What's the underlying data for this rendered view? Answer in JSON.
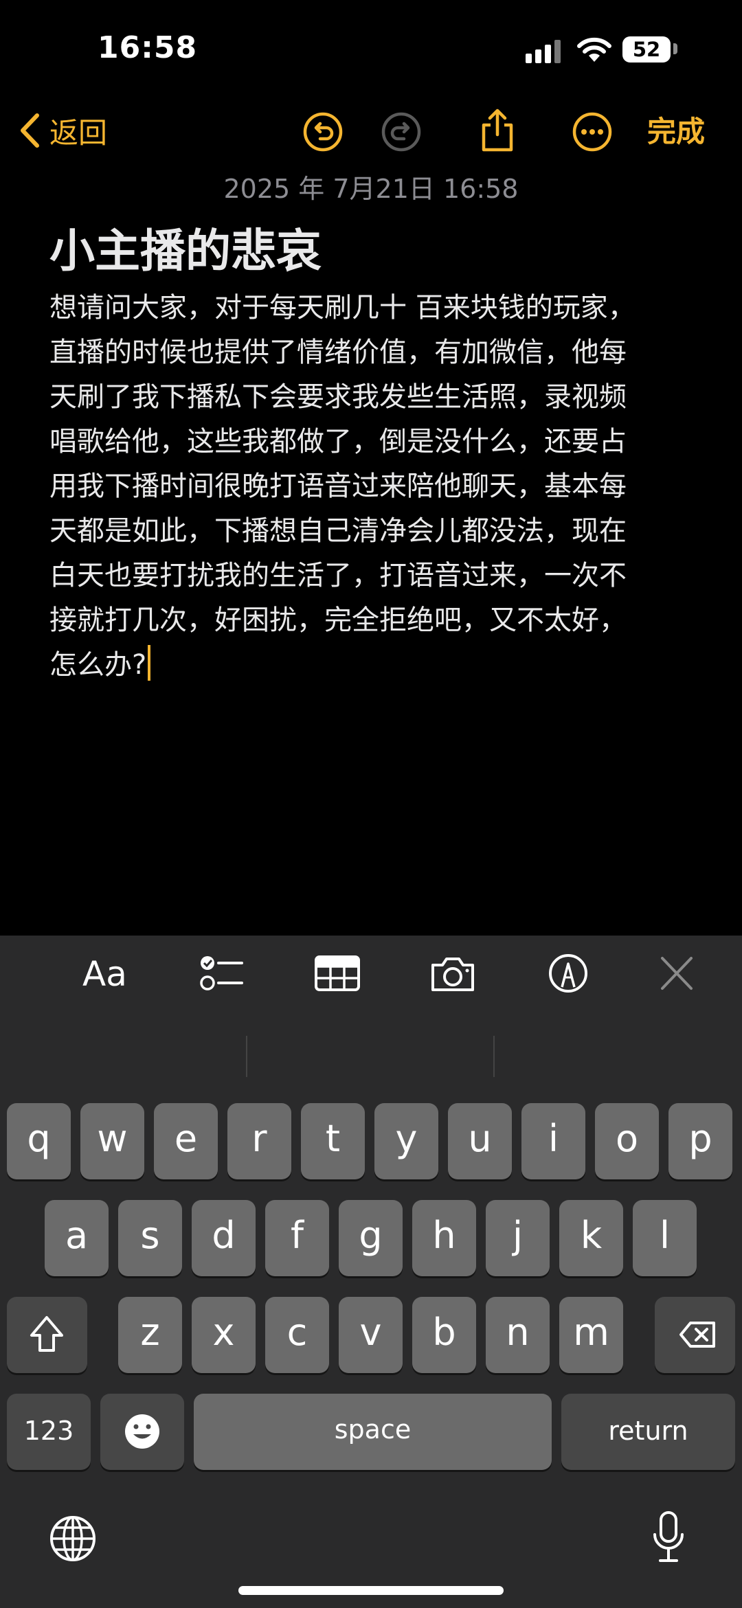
{
  "status_bar": {
    "time": "16:58",
    "battery": "52"
  },
  "nav": {
    "back_label": "返回",
    "done_label": "完成"
  },
  "note": {
    "date": "2025 年 7月21日 16:58",
    "title": "小主播的悲哀",
    "lines": [
      "想请问大家，对于每天刷几十 百来块钱的玩家，",
      "直播的时候也提供了情绪价值，有加微信，他每",
      "天刷了我下播私下会要求我发些生活照，录视频",
      "唱歌给他，这些我都做了，倒是没什么，还要占",
      "用我下播时间很晚打语音过来陪他聊天，基本每",
      "天都是如此，下播想自己清净会儿都没法，现在",
      "白天也要打扰我的生活了，打语音过来，一次不",
      "接就打几次，好困扰，完全拒绝吧，又不太好，",
      "怎么办?"
    ]
  },
  "toolbar": {
    "format_label": "Aa"
  },
  "keyboard": {
    "row1": [
      "q",
      "w",
      "e",
      "r",
      "t",
      "y",
      "u",
      "i",
      "o",
      "p"
    ],
    "row2": [
      "a",
      "s",
      "d",
      "f",
      "g",
      "h",
      "j",
      "k",
      "l"
    ],
    "row3": [
      "z",
      "x",
      "c",
      "v",
      "b",
      "n",
      "m"
    ],
    "numbers_label": "123",
    "space_label": "space",
    "return_label": "return"
  },
  "colors": {
    "accent": "#f5b530",
    "background": "#000000",
    "keyboard_bg": "#2a2a2b",
    "key": "#6b6b6b",
    "key_dark": "#474747"
  }
}
